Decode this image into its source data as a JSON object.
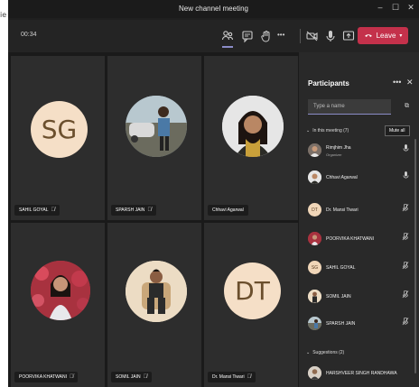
{
  "window": {
    "title": "New channel meeting",
    "minimize": "–",
    "maximize": "☐",
    "close": "✕"
  },
  "edge_text": "ie",
  "toolbar": {
    "timer": "00:34",
    "more": "•••",
    "leave_label": "Leave"
  },
  "tiles": [
    {
      "name": "SAHIL GOYAL",
      "initials": "SG",
      "mic_muted": true
    },
    {
      "name": "SPARSH JAIN",
      "mic_muted": true
    },
    {
      "name": "Chhavi Agarwal",
      "mic_muted": false
    },
    {
      "name": "POORVIKA KHATWANI",
      "mic_muted": true
    },
    {
      "name": "SOMIL JAIN",
      "mic_muted": true
    },
    {
      "name": "Dr. Mansi Tiwari",
      "initials": "DT",
      "mic_muted": true
    }
  ],
  "panel": {
    "title": "Participants",
    "more": "•••",
    "close": "✕",
    "search_placeholder": "Type a name",
    "in_meeting_label": "In this meeting (7)",
    "mute_all_label": "Mute all",
    "suggestions_label": "Suggestions (2)",
    "participants": [
      {
        "name": "Rimjhim Jha",
        "role": "Organizer",
        "mic": "on"
      },
      {
        "name": "Chhavi Agarwal",
        "mic": "on"
      },
      {
        "name": "Dr. Mansi Tiwari",
        "initials": "DT",
        "mic": "off"
      },
      {
        "name": "POORVIKA KHATWANI",
        "mic": "off"
      },
      {
        "name": "SAHIL GOYAL",
        "initials": "SG",
        "mic": "off"
      },
      {
        "name": "SOMIL JAIN",
        "mic": "off"
      },
      {
        "name": "SPARSH JAIN",
        "mic": "off"
      }
    ],
    "suggestions": [
      {
        "name": "HARSHVEER SINGH RANDHAWA"
      }
    ]
  },
  "colors": {
    "leave": "#c4314b",
    "accent": "#8b8cc7",
    "panel_bg": "#292929",
    "tile_bg": "#2d2d2d"
  }
}
